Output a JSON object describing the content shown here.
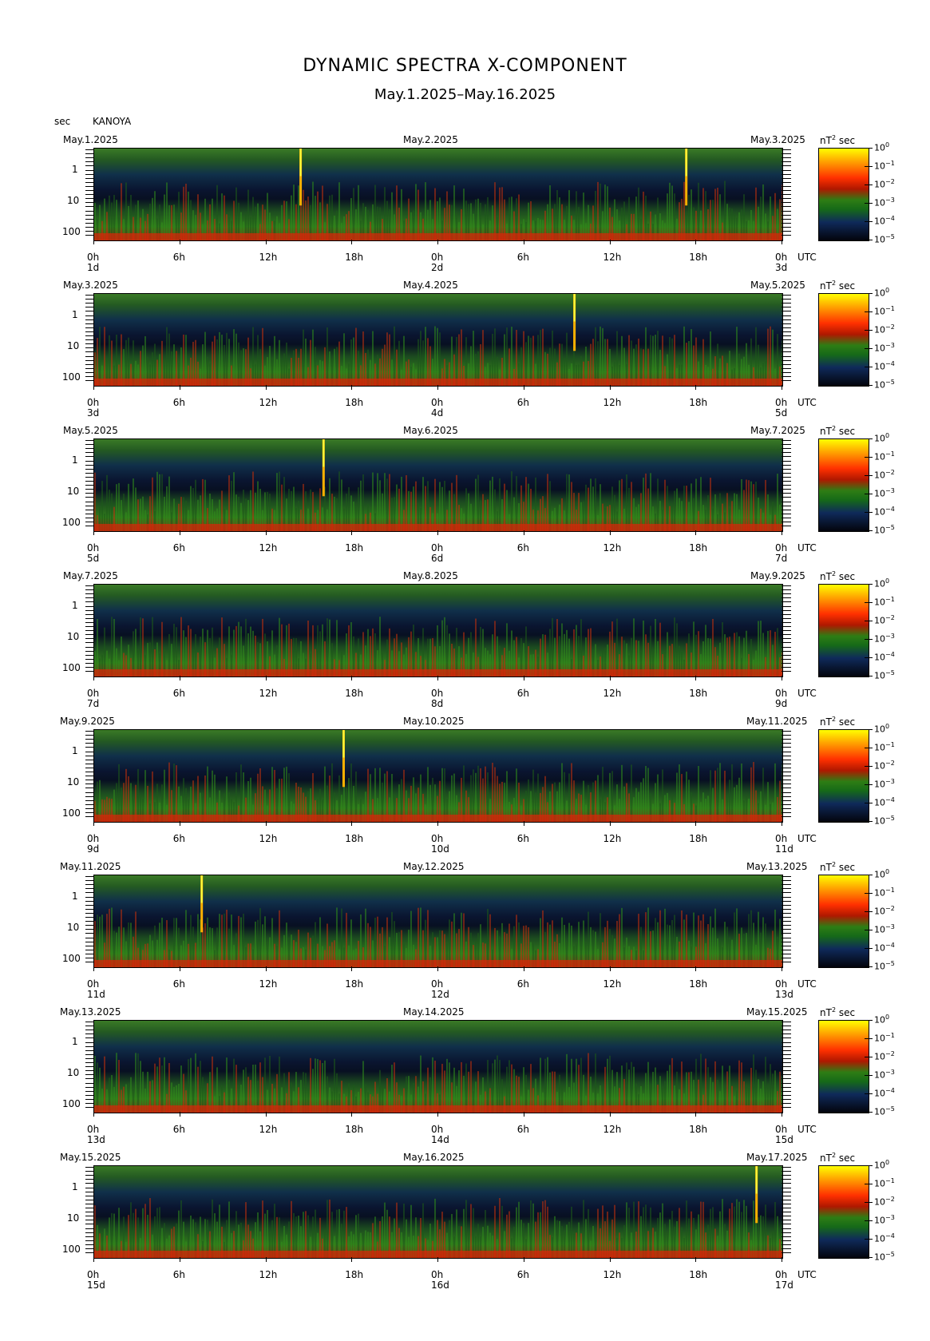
{
  "header": {
    "title": "DYNAMIC SPECTRA X-COMPONENT",
    "subtitle": "May.1.2025–May.16.2025",
    "y_unit": "sec",
    "station": "KANOYA"
  },
  "colorbar": {
    "unit": "nT",
    "unit_exp": "2",
    "unit_suffix": "sec",
    "ticks": [
      {
        "base": "10",
        "exp": "0"
      },
      {
        "base": "10",
        "exp": "−1"
      },
      {
        "base": "10",
        "exp": "−2"
      },
      {
        "base": "10",
        "exp": "−3"
      },
      {
        "base": "10",
        "exp": "−4"
      },
      {
        "base": "10",
        "exp": "−5"
      }
    ],
    "colors": [
      "#ffff00",
      "#ff3000",
      "#2e7d14",
      "#0f2a5a",
      "#03040c"
    ]
  },
  "y_ticks": [
    "1",
    "10",
    "100"
  ],
  "x_ticks": [
    "0h",
    "6h",
    "12h",
    "18h",
    "0h",
    "6h",
    "12h",
    "18h",
    "0h"
  ],
  "utc_label": "UTC",
  "panels": [
    {
      "date_left": "May.1.2025",
      "date_mid": "May.2.2025",
      "date_right": "May.3.2025",
      "day_left": "1d",
      "day_mid": "2d",
      "day_right": "3d",
      "events": [
        14.4,
        41.3
      ]
    },
    {
      "date_left": "May.3.2025",
      "date_mid": "May.4.2025",
      "date_right": "May.5.2025",
      "day_left": "3d",
      "day_mid": "4d",
      "day_right": "5d",
      "events": [
        33.5
      ]
    },
    {
      "date_left": "May.5.2025",
      "date_mid": "May.6.2025",
      "date_right": "May.7.2025",
      "day_left": "5d",
      "day_mid": "6d",
      "day_right": "7d",
      "events": [
        16.0
      ]
    },
    {
      "date_left": "May.7.2025",
      "date_mid": "May.8.2025",
      "date_right": "May.9.2025",
      "day_left": "7d",
      "day_mid": "8d",
      "day_right": "9d",
      "events": []
    },
    {
      "date_left": "May.9.2025",
      "date_mid": "May.10.2025",
      "date_right": "May.11.2025",
      "day_left": "9d",
      "day_mid": "10d",
      "day_right": "11d",
      "events": [
        17.4
      ]
    },
    {
      "date_left": "May.11.2025",
      "date_mid": "May.12.2025",
      "date_right": "May.13.2025",
      "day_left": "11d",
      "day_mid": "12d",
      "day_right": "13d",
      "events": [
        7.5
      ]
    },
    {
      "date_left": "May.13.2025",
      "date_mid": "May.14.2025",
      "date_right": "May.15.2025",
      "day_left": "13d",
      "day_mid": "14d",
      "day_right": "15d",
      "events": []
    },
    {
      "date_left": "May.15.2025",
      "date_mid": "May.16.2025",
      "date_right": "May.17.2025",
      "day_left": "15d",
      "day_mid": "16d",
      "day_right": "17d",
      "events": [
        46.2
      ]
    }
  ],
  "chart_data": {
    "type": "heatmap",
    "title": "DYNAMIC SPECTRA X-COMPONENT",
    "subtitle": "May.1.2025–May.16.2025",
    "ylabel": "sec",
    "y_scale": "log",
    "y_ticks": [
      1,
      10,
      100
    ],
    "x_ticks_hours": [
      0,
      6,
      12,
      18,
      24,
      30,
      36,
      42,
      48
    ],
    "x_unit": "UTC",
    "color_scale": "log",
    "color_unit": "nT^2 sec",
    "color_range": [
      1e-05,
      1
    ],
    "panel_count": 8,
    "panel_span_hours": 48
  }
}
